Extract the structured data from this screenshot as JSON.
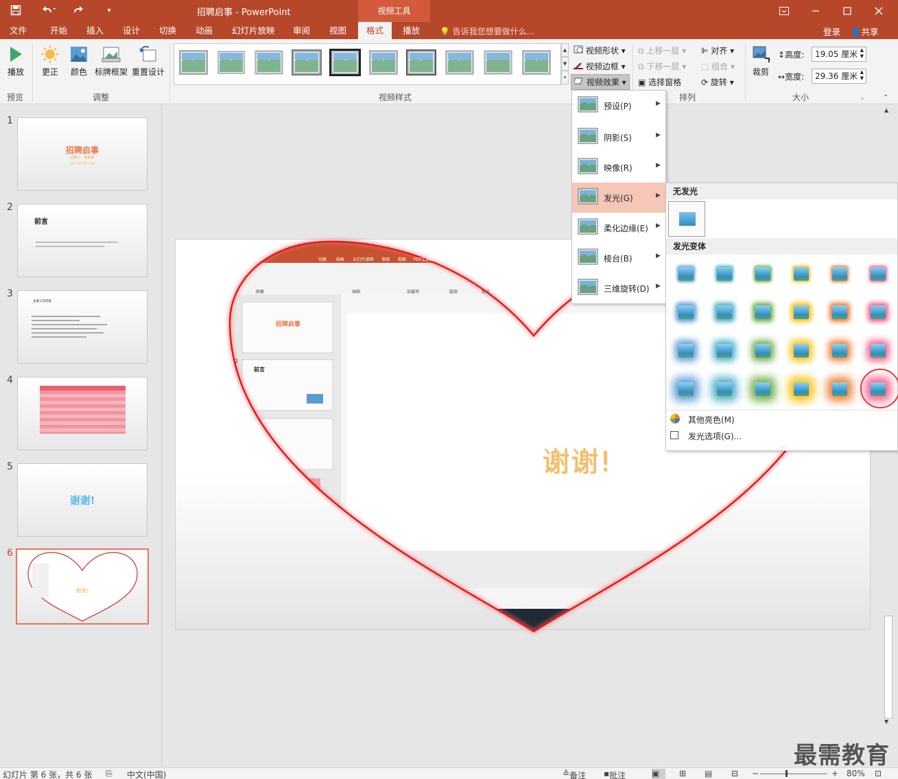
{
  "titlebar": {
    "doc_title": "招聘启事 - PowerPoint",
    "context_tab_header": "视频工具",
    "icons": [
      "save-icon",
      "undo-icon",
      "redo-icon",
      "customize-qat-icon",
      "ribbon-display-icon",
      "minimize-icon",
      "maximize-icon",
      "close-icon"
    ]
  },
  "tabs": [
    "文件",
    "开始",
    "插入",
    "设计",
    "切换",
    "动画",
    "幻灯片放映",
    "审阅",
    "视图",
    "格式",
    "播放"
  ],
  "active_tab": "格式",
  "tellme": "告诉我您想要做什么...",
  "login": "登录",
  "share": "共享",
  "ribbon": {
    "preview": {
      "play": "播放",
      "group": "预览"
    },
    "adjust": {
      "correct": "更正",
      "color": "颜色",
      "poster_frame": "标牌框架",
      "reset": "重置设计",
      "group": "调整"
    },
    "video_styles": {
      "group": "视频样式",
      "shape": "视频形状",
      "border": "视频边框",
      "effects": "视频效果"
    },
    "arrange": {
      "bring_forward": "上移一层",
      "send_backward": "下移一层",
      "selection_pane": "选择窗格",
      "align": "对齐",
      "group_cmd": "组合",
      "rotate": "旋转",
      "group": "排列"
    },
    "size": {
      "crop": "裁剪",
      "height_label": "高度:",
      "height_value": "19.05 厘米",
      "width_label": "宽度:",
      "width_value": "29.36 厘米",
      "group": "大小"
    }
  },
  "slides": [
    {
      "num": "1",
      "title": "招聘启事",
      "sub1": "招聘人：某某某",
      "sub2": "2021年3月12日"
    },
    {
      "num": "2",
      "title": "前言"
    },
    {
      "num": "3",
      "title": "主要工作内容"
    },
    {
      "num": "4"
    },
    {
      "num": "5",
      "title": "谢谢!"
    },
    {
      "num": "6",
      "title": "谢谢!"
    }
  ],
  "effects_menu": [
    {
      "label": "预设(P)"
    },
    {
      "label": "阴影(S)"
    },
    {
      "label": "映像(R)"
    },
    {
      "label": "发光(G)"
    },
    {
      "label": "柔化边缘(E)"
    },
    {
      "label": "棱台(B)"
    },
    {
      "label": "三维旋转(D)"
    }
  ],
  "glow_panel": {
    "no_glow": "无发光",
    "variations": "发光变体",
    "more_colors": "其他亮色(M)",
    "glow_options": "发光选项(G)...",
    "glow_colors": [
      "#5b9bd5",
      "#4bacc6",
      "#70ad47",
      "#ffc000",
      "#ed7d31",
      "#ff5a8a"
    ]
  },
  "slide_content": {
    "thanks": "谢谢!",
    "inner_tabs": [
      "切换",
      "动画",
      "幻灯片放映",
      "审阅",
      "视图",
      "PDF工具集"
    ],
    "inner_groups": [
      "图像",
      "插图",
      "加载项",
      "链接",
      "批注"
    ],
    "inner_slide1_title": "招聘启事",
    "inner_slide2_title": "前言",
    "inner_slide_num": "2"
  },
  "status": {
    "slide_info": "幻灯片 第 6 张，共 6 张",
    "language": "中文(中国)",
    "notes": "备注",
    "comments": "批注",
    "zoom": "80%"
  },
  "watermark": "最需教育"
}
